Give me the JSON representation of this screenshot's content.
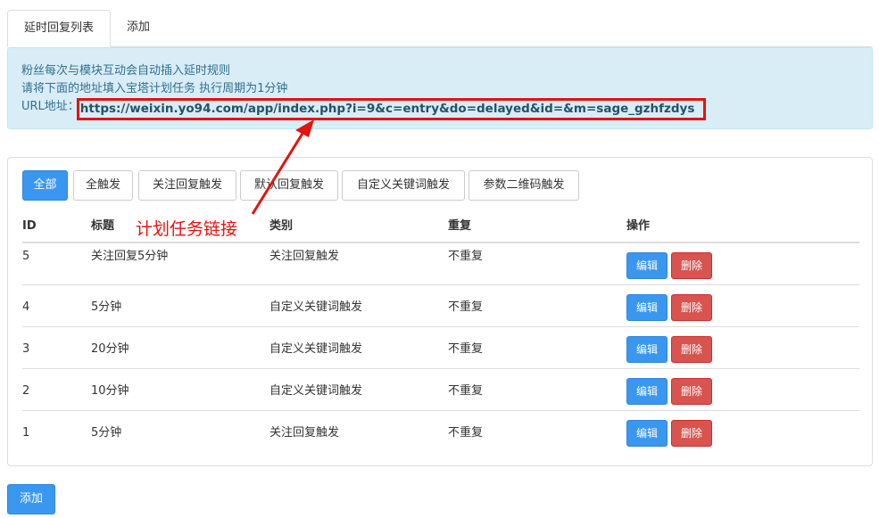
{
  "tabs": [
    {
      "label": "延时回复列表",
      "active": true
    },
    {
      "label": "添加",
      "active": false
    }
  ],
  "alert": {
    "line1": "粉丝每次与模块互动会自动插入延时规则",
    "line2": "请将下面的地址填入宝塔计划任务 执行周期为1分钟",
    "url_label": "URL地址：",
    "url": "https://weixin.yo94.com/app/index.php?i=9&c=entry&do=delayed&id=&m=sage_gzhfzdys"
  },
  "filters": [
    {
      "label": "全部",
      "active": true
    },
    {
      "label": "全触发",
      "active": false
    },
    {
      "label": "关注回复触发",
      "active": false
    },
    {
      "label": "默认回复触发",
      "active": false
    },
    {
      "label": "自定义关键词触发",
      "active": false
    },
    {
      "label": "参数二维码触发",
      "active": false
    }
  ],
  "table": {
    "headers": [
      "ID",
      "标题",
      "类别",
      "重复",
      "操作"
    ],
    "rows": [
      {
        "id": "5",
        "title": "关注回复5分钟",
        "category": "关注回复触发",
        "repeat": "不重复"
      },
      {
        "id": "4",
        "title": "5分钟",
        "category": "自定义关键词触发",
        "repeat": "不重复"
      },
      {
        "id": "3",
        "title": "20分钟",
        "category": "自定义关键词触发",
        "repeat": "不重复"
      },
      {
        "id": "2",
        "title": "10分钟",
        "category": "自定义关键词触发",
        "repeat": "不重复"
      },
      {
        "id": "1",
        "title": "5分钟",
        "category": "关注回复触发",
        "repeat": "不重复"
      }
    ],
    "edit_label": "编辑",
    "delete_label": "删除"
  },
  "add_button": "添加",
  "annotation": "计划任务链接",
  "colors": {
    "primary": "#3a97f0",
    "danger": "#d9534f",
    "alert_bg": "#d9edf7",
    "alert_text": "#31708f",
    "annotation": "#e3130f"
  }
}
